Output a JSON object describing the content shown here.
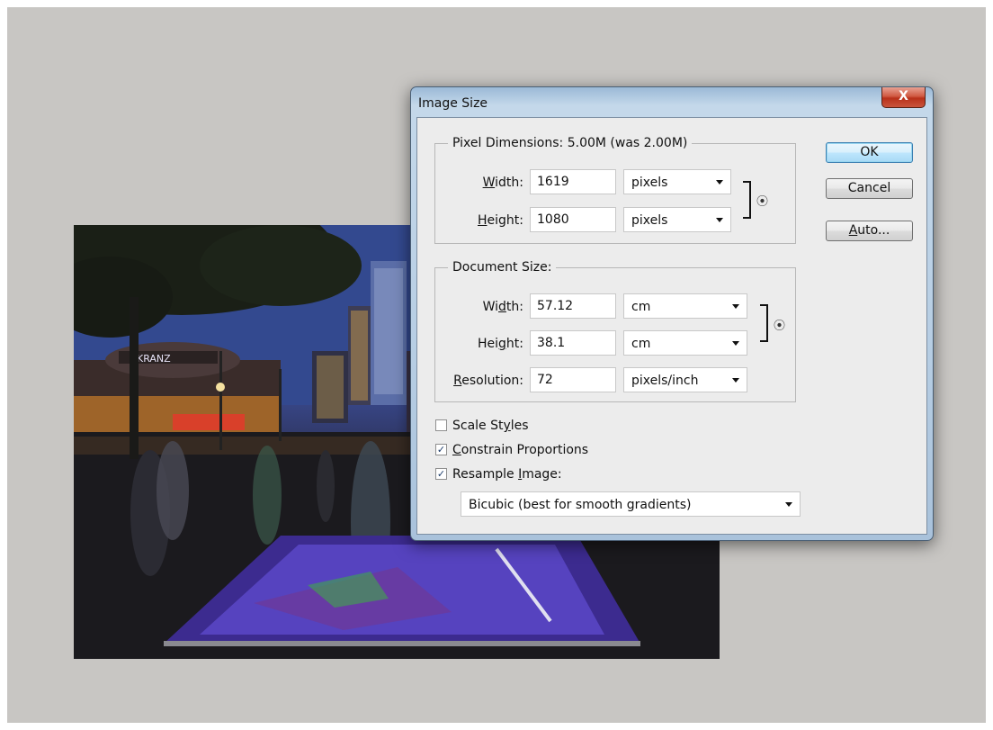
{
  "dialog": {
    "title": "Image Size",
    "close_label": "X"
  },
  "pixel_dimensions": {
    "legend": "Pixel Dimensions:  5.00M (was 2.00M)",
    "width_label": "Width:",
    "width_value": "1619",
    "width_unit": "pixels",
    "height_label": "Height:",
    "height_value": "1080",
    "height_unit": "pixels"
  },
  "document_size": {
    "legend": "Document Size:",
    "width_label": "Width:",
    "width_value": "57.12",
    "width_unit": "cm",
    "height_label": "Height:",
    "height_value": "38.1",
    "height_unit": "cm",
    "resolution_label": "Resolution:",
    "resolution_value": "72",
    "resolution_unit": "pixels/inch"
  },
  "options": {
    "scale_styles": {
      "label": "Scale Styles",
      "checked": false
    },
    "constrain_proportions": {
      "label": "Constrain Proportions",
      "checked": true
    },
    "resample_image": {
      "label": "Resample Image:",
      "checked": true
    },
    "resample_method": "Bicubic (best for smooth gradients)"
  },
  "buttons": {
    "ok": "OK",
    "cancel": "Cancel",
    "auto": "Auto..."
  },
  "icons": {
    "link_chain": "chain-link-icon",
    "close": "close-icon",
    "dropdown": "chevron-down-icon",
    "checkmark": "checkmark-icon"
  }
}
